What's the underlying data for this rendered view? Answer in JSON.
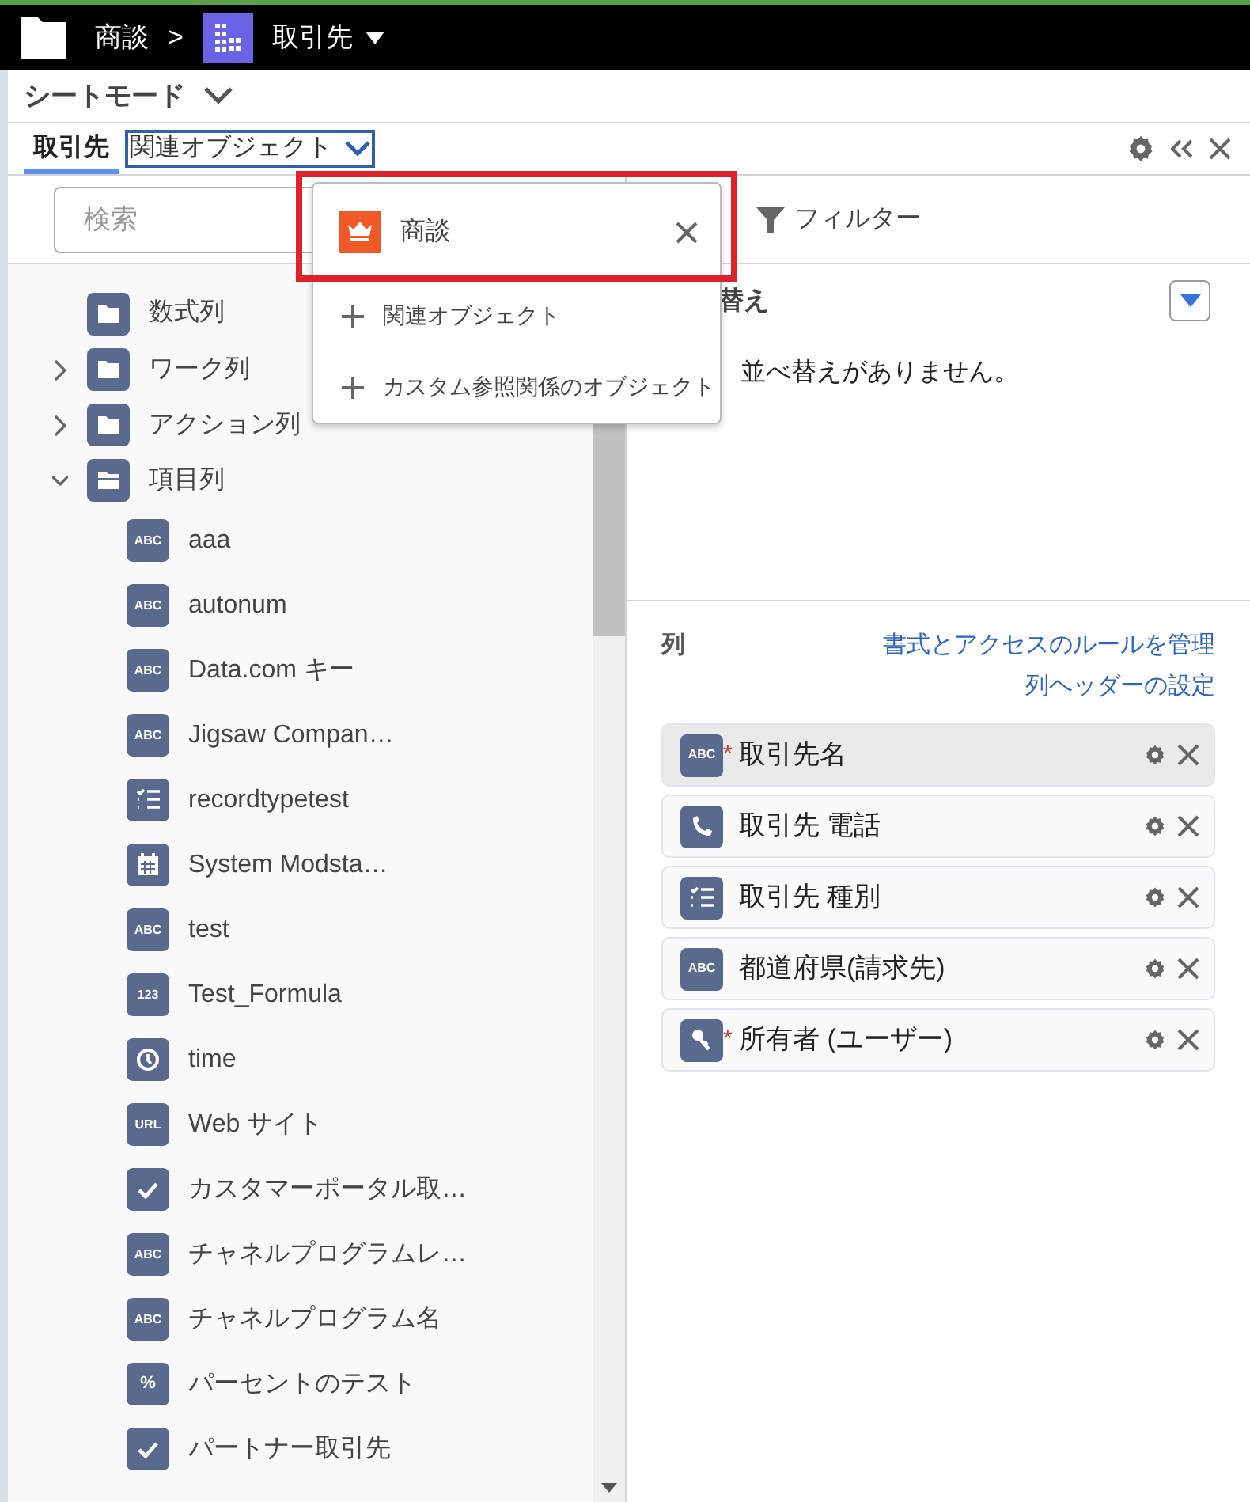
{
  "breadcrumb": {
    "parent": "商談",
    "separator": ">",
    "current": "取引先"
  },
  "mode": {
    "label": "シートモード"
  },
  "object_tabs": [
    {
      "label": "取引先",
      "selected": true
    },
    {
      "label": "関連オブジェクト",
      "selected": false
    }
  ],
  "search": {
    "placeholder": "検索"
  },
  "tree": [
    {
      "label": "数式列",
      "kind": "folder"
    },
    {
      "label": "ワーク列",
      "kind": "group",
      "expanded": false
    },
    {
      "label": "アクション列",
      "kind": "group",
      "expanded": false
    },
    {
      "label": "項目列",
      "kind": "group",
      "expanded": true,
      "children": [
        {
          "label": "aaa",
          "kind": "text",
          "badge": "ABC"
        },
        {
          "label": "autonum",
          "kind": "text",
          "badge": "ABC"
        },
        {
          "label": "Data.com キー",
          "kind": "text",
          "badge": "ABC"
        },
        {
          "label": "Jigsaw Compan…",
          "kind": "text",
          "badge": "ABC"
        },
        {
          "label": "recordtypetest",
          "kind": "list"
        },
        {
          "label": "System Modsta…",
          "kind": "calendar"
        },
        {
          "label": "test",
          "kind": "text",
          "badge": "ABC"
        },
        {
          "label": "Test_Formula",
          "kind": "number",
          "badge": "123"
        },
        {
          "label": "time",
          "kind": "clock"
        },
        {
          "label": "Web サイト",
          "kind": "url",
          "badge": "URL"
        },
        {
          "label": "カスタマーポータル取…",
          "kind": "check"
        },
        {
          "label": "チャネルプログラムレ…",
          "kind": "text",
          "badge": "ABC"
        },
        {
          "label": "チャネルプログラム名",
          "kind": "text",
          "badge": "ABC"
        },
        {
          "label": "パーセントのテスト",
          "kind": "percent",
          "badge": "%"
        },
        {
          "label": "パートナー取引先",
          "kind": "check"
        }
      ]
    }
  ],
  "right_tabs": [
    {
      "label": "フィルター",
      "selected": false
    }
  ],
  "sort": {
    "heading": "替え",
    "empty": "並べ替えがありません。"
  },
  "columns": {
    "heading": "列",
    "links": [
      "書式とアクセスのルールを管理",
      "列ヘッダーの設定"
    ],
    "items": [
      {
        "label": "取引先名",
        "marker": "*",
        "kind": "text",
        "badge": "ABC",
        "selected": true
      },
      {
        "label": "取引先 電話",
        "kind": "phone",
        "selected": false
      },
      {
        "label": "取引先 種別",
        "kind": "list",
        "selected": false
      },
      {
        "label": "都道府県(請求先)",
        "kind": "text",
        "badge": "ABC",
        "selected": false
      },
      {
        "label": "所有者 (ユーザー)",
        "marker": "*",
        "kind": "lookup",
        "selected": false
      }
    ]
  },
  "popup": {
    "items": [
      {
        "label": "商談",
        "kind": "object",
        "highlighted": true
      },
      {
        "label": "関連オブジェクト",
        "kind": "add"
      },
      {
        "label": "カスタム参照関係のオブジェクト",
        "kind": "add"
      }
    ]
  }
}
